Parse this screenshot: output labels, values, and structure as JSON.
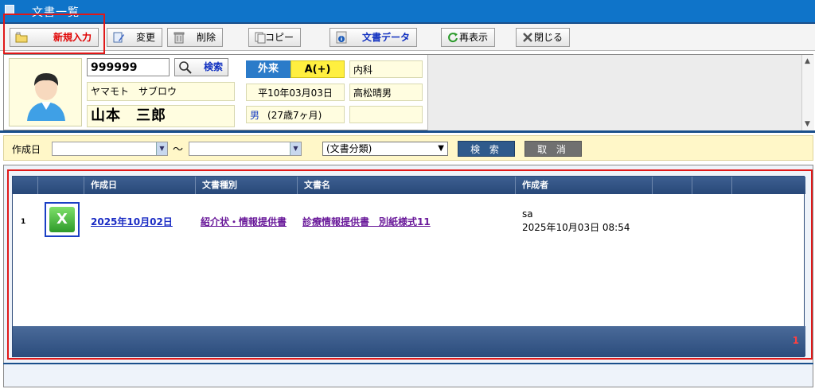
{
  "window": {
    "title": "文書一覧"
  },
  "toolbar": {
    "new_label": "新規入力",
    "edit_label": "変更",
    "delete_label": "削除",
    "copy_label": "コピー",
    "doc_data_label": "文書データ",
    "reload_label": "再表示",
    "close_label": "閉じる"
  },
  "patient": {
    "id": "999999",
    "search_label": "検索",
    "kana": "ヤマモト　サブロウ",
    "name": "山本　三郎",
    "visit_type": "外来",
    "insurance": "A(+)",
    "department": "内科",
    "birth_date": "平10年03月03日",
    "doctor": "高松晴男",
    "sex": "男",
    "age": "(27歳7ヶ月)"
  },
  "filter": {
    "date_label": "作成日",
    "range_sep": "～",
    "category_selected": "(文書分類)",
    "search_label": "検 索",
    "cancel_label": "取 消"
  },
  "grid": {
    "headers": [
      "作成日",
      "文書種別",
      "文書名",
      "作成者"
    ],
    "rows": [
      {
        "num": "1",
        "created": "2025年10月02日",
        "doc_type": "紹介状・情報提供書",
        "doc_name": "診療情報提供書　別紙様式11",
        "author": "sa",
        "author_time": "2025年10月03日 08:54"
      }
    ],
    "page": "1"
  },
  "colors": {
    "title_bar": "#0f74c9",
    "highlight": "#e01818",
    "grid_header": "#2d4a78"
  }
}
